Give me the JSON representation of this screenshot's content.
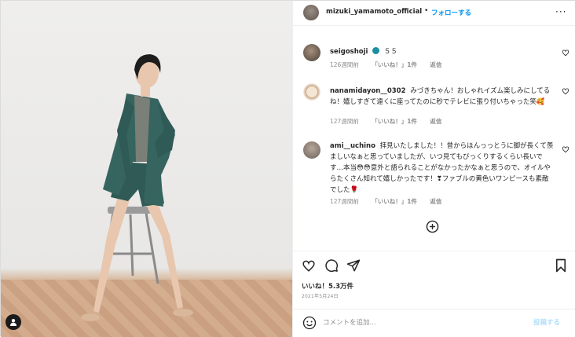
{
  "header": {
    "username": "mizuki_yamamoto_official",
    "separator": "•",
    "follow_label": "フォローする",
    "more_label": "···"
  },
  "comments": [
    {
      "username": "seigoshoji",
      "text": "５５",
      "age": "126週間前",
      "likes": "「いいね！」1件",
      "reply": "返信"
    },
    {
      "username": "nanamidayon__0302",
      "text": "みづきちゃん！おしゃれイズム楽しみにしてるね！嬉しすぎて遠くに座ってたのに秒でテレビに張り付いちゃった笑🥰",
      "age": "127週間前",
      "likes": "「いいね！」1件",
      "reply": "返信"
    },
    {
      "username": "ami__uchino",
      "text": "拝見いたしました！！昔からほんっっとうに脚が長くて羨ましいなぁと思っていましたが、いつ見てもびっくりするくらい長いです…本当😳😳意外と語られることがなかったかなぁと思うので、オイルやらたくさん知れて嬉しかったです！❣ファブルの黄色いワンピースも素敵でした🌹",
      "age": "127週間前",
      "likes": "「いいね！」1件",
      "reply": "返信"
    }
  ],
  "footer": {
    "likes_text": "いいね！5.3万件",
    "date_text": "2021年5月24日"
  },
  "compose": {
    "placeholder": "コメントを追加...",
    "post_label": "投稿する"
  },
  "colors": {
    "accent": "#0095f6",
    "muted": "#8e8e8e",
    "post_disabled": "#b2dffc"
  }
}
